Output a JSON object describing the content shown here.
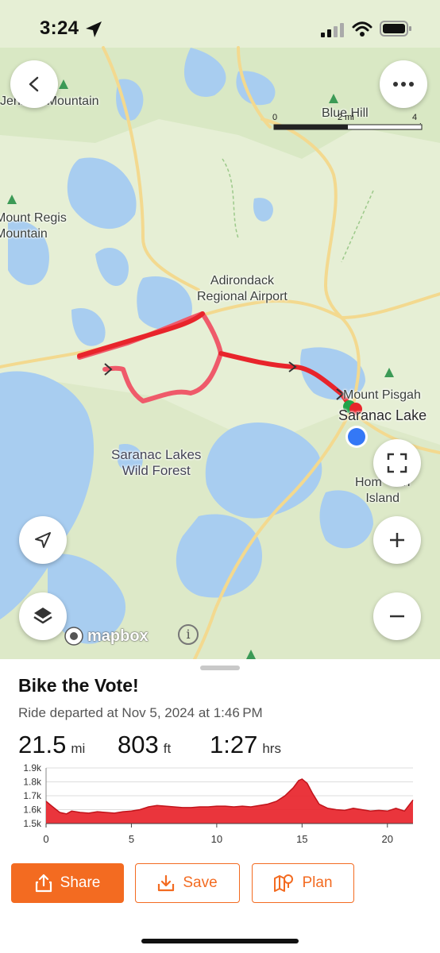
{
  "status": {
    "time": "3:24"
  },
  "map": {
    "labels": {
      "jenkins_mountain": "Jenkins Mountain",
      "blue_hill": "Blue Hill",
      "mount_regis": "Mount Regis\nMountain",
      "airport": "Adirondack\nRegional Airport",
      "mount_pisgah": "Mount Pisgah",
      "saranac_lake": "Saranac Lake",
      "wild_forest": "Saranac Lakes\nWild Forest",
      "island": "Hom  oon\nIsland"
    },
    "scale": {
      "zero": "0",
      "mid": "2 mi",
      "max": "4 mi"
    },
    "attribution": "mapbox",
    "icons": [
      "back-icon",
      "more-icon",
      "fullscreen-icon",
      "plus-icon",
      "minus-icon",
      "location-arrow-icon",
      "layers-icon",
      "info-icon"
    ]
  },
  "ride": {
    "title": "Bike the Vote!",
    "subtitle": "Ride departed at Nov 5, 2024 at 1:46 PM",
    "distance": {
      "value": "21.5",
      "unit": "mi"
    },
    "elevation": {
      "value": "803",
      "unit": "ft"
    },
    "time": {
      "value": "1:27",
      "unit": "hrs"
    }
  },
  "chart_data": {
    "type": "area",
    "title": "",
    "xlabel": "",
    "ylabel": "",
    "xlim": [
      0,
      21.5
    ],
    "ylim": [
      1500,
      1900
    ],
    "y_tick_labels": [
      "1.9k",
      "1.8k",
      "1.7k",
      "1.6k",
      "1.5k"
    ],
    "x_tick_labels": [
      "0",
      "5",
      "10",
      "15",
      "20"
    ],
    "color": "#e8242b",
    "x": [
      0,
      0.3,
      0.8,
      1.2,
      1.5,
      2,
      2.5,
      3,
      3.5,
      4,
      4.5,
      5,
      5.5,
      6,
      6.5,
      7,
      7.5,
      8,
      8.5,
      9,
      9.5,
      10,
      10.5,
      11,
      11.5,
      12,
      12.5,
      13,
      13.5,
      14,
      14.5,
      14.8,
      15,
      15.3,
      15.6,
      16,
      16.5,
      17,
      17.5,
      18,
      18.5,
      19,
      19.5,
      20,
      20.5,
      21,
      21.5
    ],
    "y": [
      1660,
      1630,
      1580,
      1570,
      1590,
      1580,
      1575,
      1585,
      1580,
      1575,
      1585,
      1590,
      1600,
      1620,
      1630,
      1625,
      1620,
      1615,
      1615,
      1620,
      1620,
      1625,
      1625,
      1620,
      1625,
      1620,
      1630,
      1640,
      1660,
      1700,
      1760,
      1810,
      1820,
      1790,
      1720,
      1640,
      1610,
      1600,
      1595,
      1610,
      1600,
      1590,
      1595,
      1590,
      1610,
      1590,
      1670
    ]
  },
  "actions": {
    "share": "Share",
    "save": "Save",
    "plan": "Plan"
  },
  "colors": {
    "accent": "#f36b21",
    "route": "#e8242b",
    "route_alt": "#ef5a6a",
    "water": "#a8cdf0",
    "land": "#e6efd5"
  }
}
